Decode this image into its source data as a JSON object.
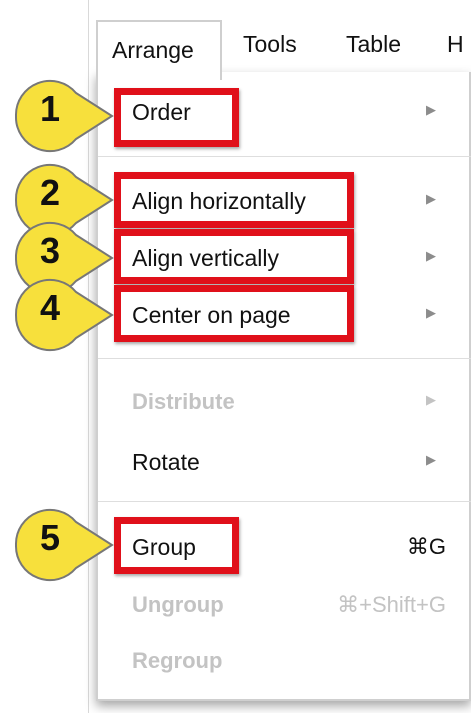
{
  "menubar": {
    "items": [
      {
        "label": "Arrange",
        "active": true
      },
      {
        "label": "Tools"
      },
      {
        "label": "Table"
      },
      {
        "label": "H"
      }
    ]
  },
  "menu": {
    "items": [
      {
        "label": "Order",
        "submenu_arrow": "▶",
        "enabled": true
      },
      {
        "label": "Align horizontally",
        "submenu_arrow": "▶",
        "enabled": true
      },
      {
        "label": "Align vertically",
        "submenu_arrow": "▶",
        "enabled": true
      },
      {
        "label": "Center on page",
        "submenu_arrow": "▶",
        "enabled": true
      },
      {
        "label": "Distribute",
        "submenu_arrow": "▶",
        "enabled": false
      },
      {
        "label": "Rotate",
        "submenu_arrow": "▶",
        "enabled": true
      },
      {
        "label": "Group",
        "shortcut": "⌘G",
        "enabled": true
      },
      {
        "label": "Ungroup",
        "shortcut": "⌘+Shift+G",
        "enabled": false
      },
      {
        "label": "Regroup",
        "enabled": false
      }
    ]
  },
  "callouts": [
    "1",
    "2",
    "3",
    "4",
    "5"
  ],
  "colors": {
    "highlight": "#e0101a",
    "callout_fill": "#f7e03c",
    "callout_stroke": "#777777",
    "disabled_text": "#c3c3c3"
  }
}
